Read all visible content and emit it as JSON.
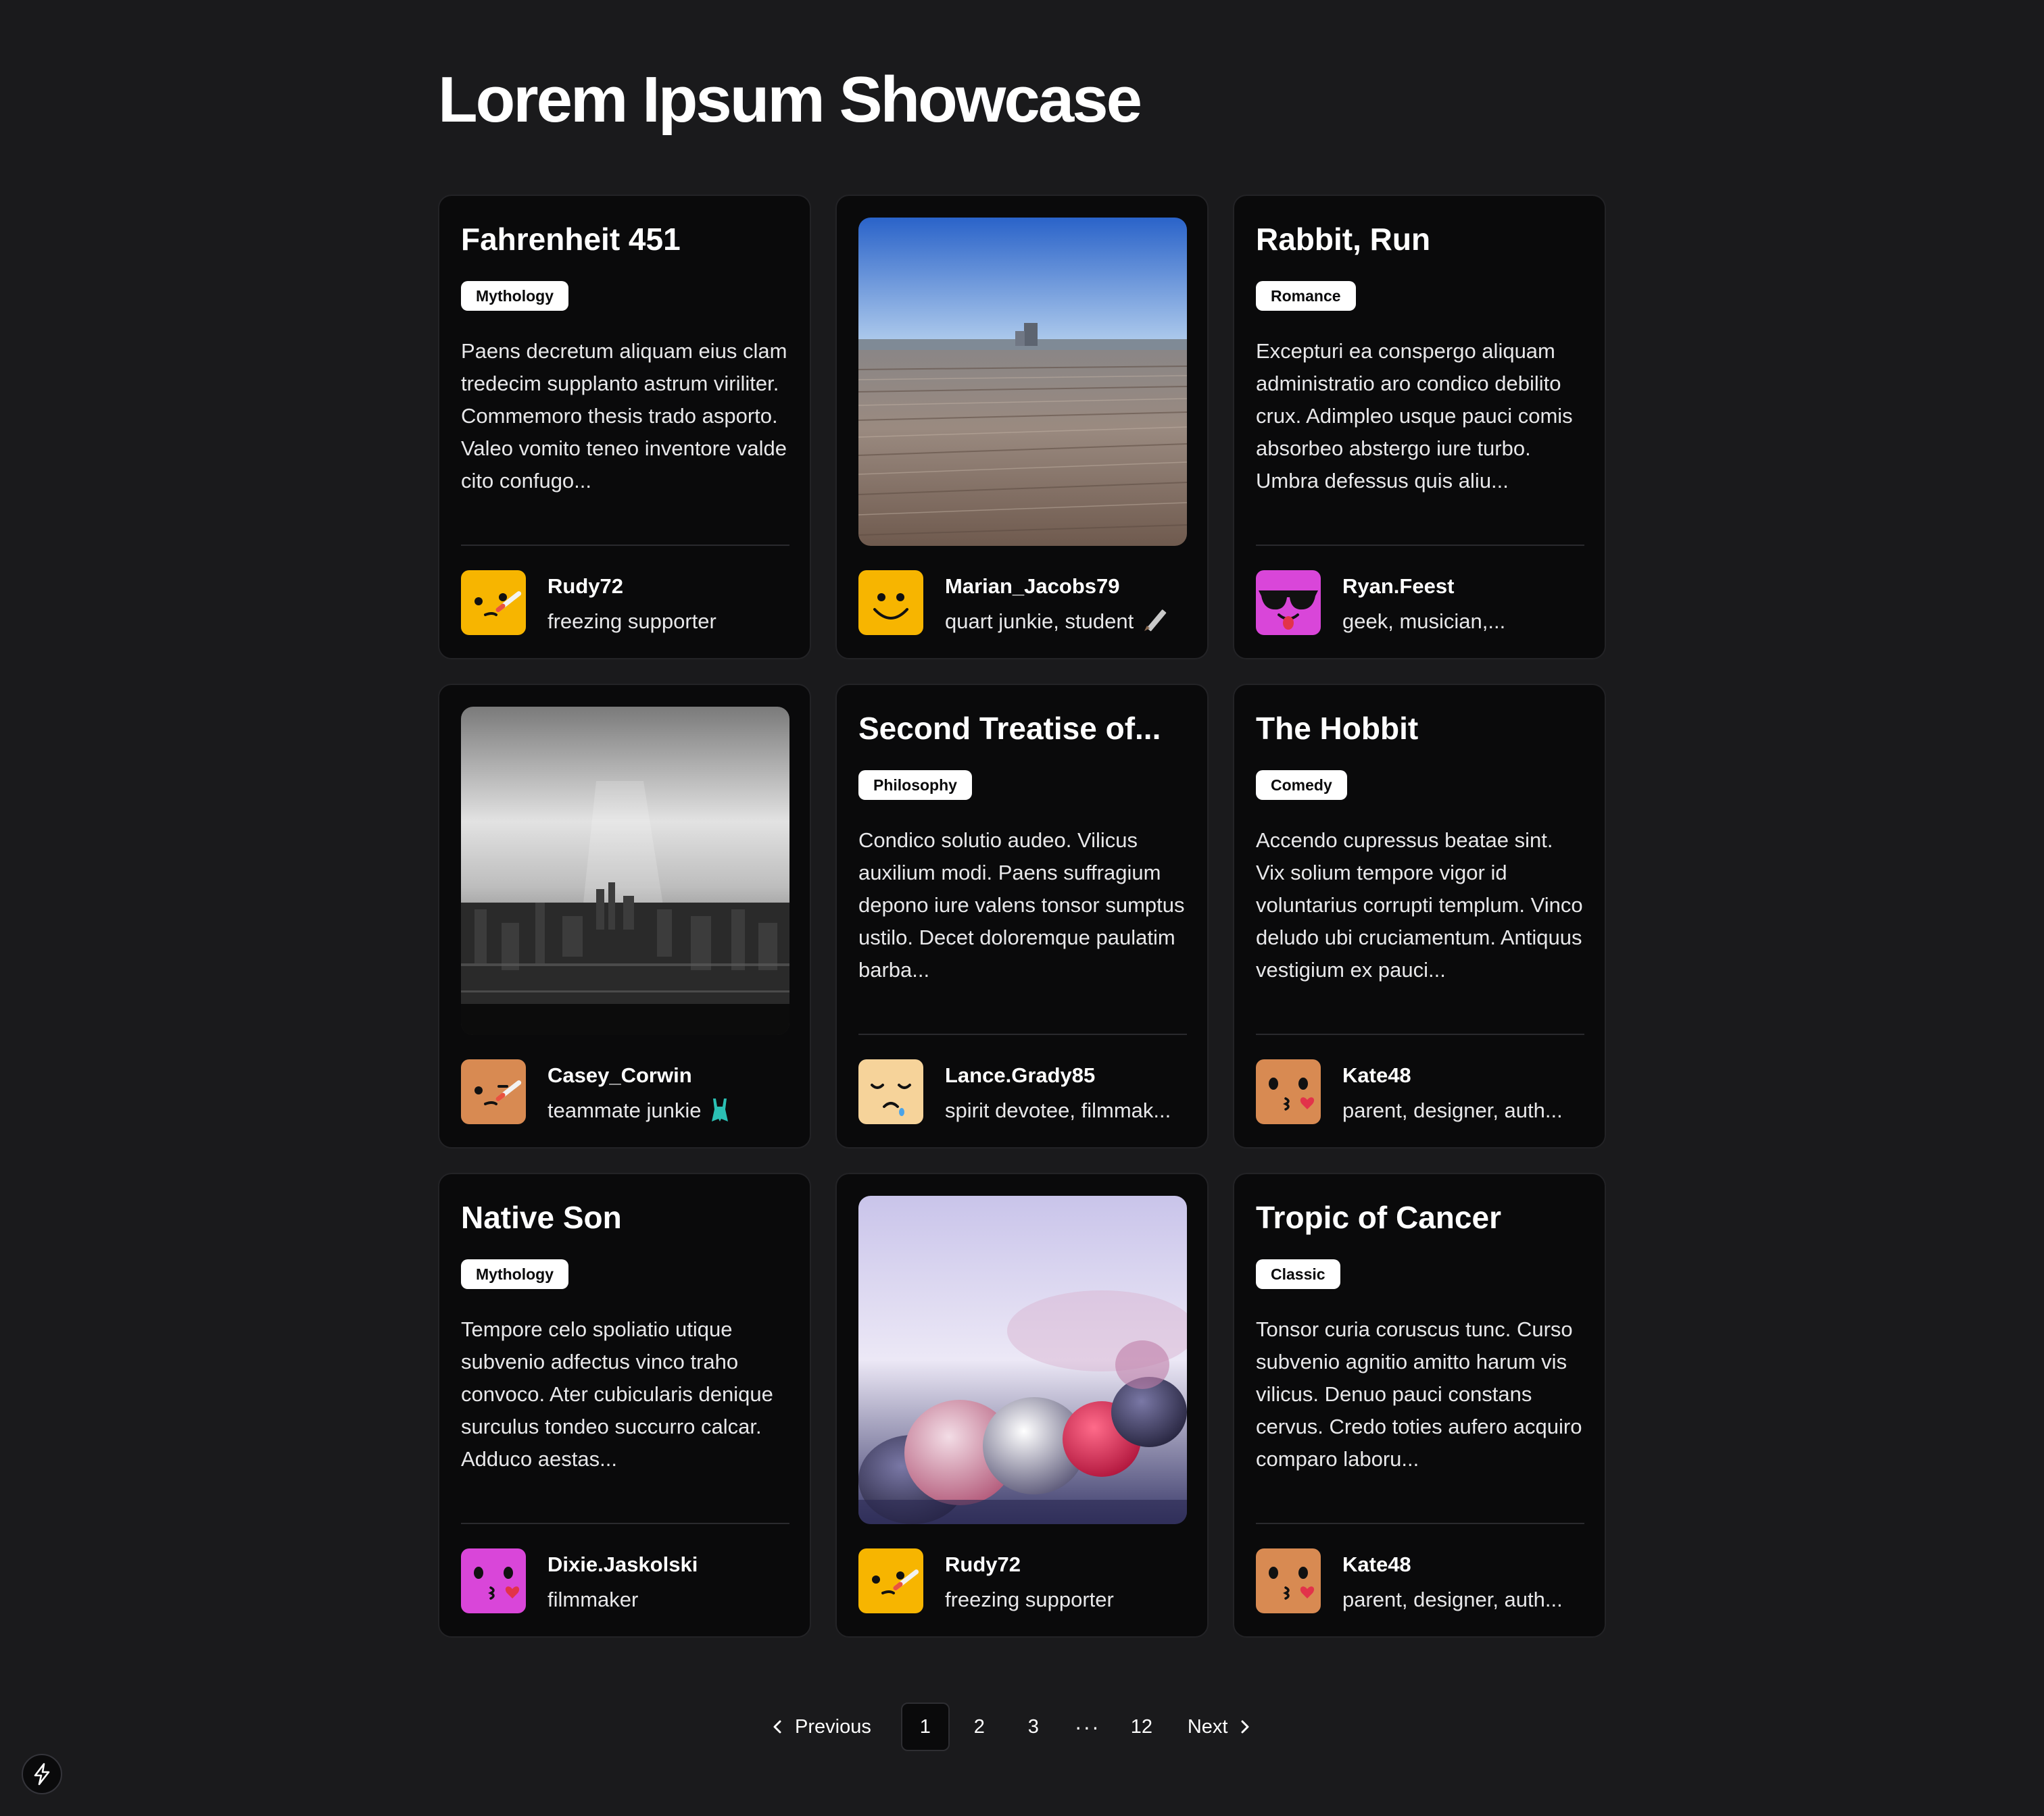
{
  "page": {
    "title": "Lorem Ipsum Showcase"
  },
  "cards": [
    {
      "kind": "text",
      "title": "Fahrenheit 451",
      "tag": "Mythology",
      "excerpt": "Paens decretum aliquam eius clam tredecim supplanto astrum viriliter. Commemoro thesis trado asporto. Valeo vomito teneo inventore valde cito confugo...",
      "author": {
        "name": "Rudy72",
        "bio": "freezing supporter",
        "avatar_color": "#f7b500",
        "avatar_icon": "face-with-thermometer-icon"
      }
    },
    {
      "kind": "image",
      "image_icon": "wooden-deck-photo",
      "author": {
        "name": "Marian_Jacobs79",
        "bio": "quart junkie, student",
        "bio_emoji": "pencil-icon",
        "avatar_color": "#f7b500",
        "avatar_icon": "smiling-face-icon"
      }
    },
    {
      "kind": "text",
      "title": "Rabbit, Run",
      "tag": "Romance",
      "excerpt": "Excepturi ea conspergo aliquam administratio aro condico debilito crux. Adimpleo usque pauci comis absorbeo abstergo iure turbo. Umbra defessus quis aliu...",
      "author": {
        "name": "Ryan.Feest",
        "bio": "geek, musician,...",
        "avatar_color": "#d946d9",
        "avatar_icon": "sunglasses-face-icon"
      }
    },
    {
      "kind": "image",
      "image_icon": "city-skyline-photo",
      "author": {
        "name": "Casey_Corwin",
        "bio": "teammate junkie",
        "bio_emoji": "swimsuit-icon",
        "avatar_color": "#d88a52",
        "avatar_icon": "face-with-thermometer-icon"
      }
    },
    {
      "kind": "text",
      "title": "Second Treatise of...",
      "tag": "Philosophy",
      "excerpt": "Condico solutio audeo. Vilicus auxilium modi. Paens suffragium depono iure valens tonsor sumptus ustilo. Decet doloremque paulatim barba...",
      "author": {
        "name": "Lance.Grady85",
        "bio": "spirit devotee, filmmak...",
        "avatar_color": "#f6d39a",
        "avatar_icon": "sleepy-face-icon"
      }
    },
    {
      "kind": "text",
      "title": "The Hobbit",
      "tag": "Comedy",
      "excerpt": "Accendo cupressus beatae sint. Vix solium tempore vigor id voluntarius corrupti templum. Vinco deludo ubi cruciamentum. Antiquus vestigium ex pauci...",
      "author": {
        "name": "Kate48",
        "bio": "parent, designer, auth...",
        "avatar_color": "#d88a52",
        "avatar_icon": "kissing-face-icon"
      }
    },
    {
      "kind": "text",
      "title": "Native Son",
      "tag": "Mythology",
      "excerpt": "Tempore celo spoliatio utique subvenio adfectus vinco traho convoco. Ater cubicularis denique surculus tondeo succurro calcar. Adduco aestas...",
      "author": {
        "name": "Dixie.Jaskolski",
        "bio": "filmmaker",
        "avatar_color": "#d946d9",
        "avatar_icon": "kissing-face-icon"
      }
    },
    {
      "kind": "image",
      "image_icon": "frozen-berries-photo",
      "author": {
        "name": "Rudy72",
        "bio": "freezing supporter",
        "avatar_color": "#f7b500",
        "avatar_icon": "face-with-thermometer-icon"
      }
    },
    {
      "kind": "text",
      "title": "Tropic of Cancer",
      "tag": "Classic",
      "excerpt": "Tonsor curia coruscus tunc. Curso subvenio agnitio amitto harum vis vilicus. Denuo pauci constans cervus. Credo toties aufero acquiro comparo laboru...",
      "author": {
        "name": "Kate48",
        "bio": "parent, designer, auth...",
        "avatar_color": "#d88a52",
        "avatar_icon": "kissing-face-icon"
      }
    }
  ],
  "pagination": {
    "previous_label": "Previous",
    "next_label": "Next",
    "pages": [
      "1",
      "2",
      "3"
    ],
    "ellipsis": "···",
    "last_page": "12",
    "current_page": "1"
  },
  "corner_button": {
    "icon": "lightning-bolt-icon"
  }
}
